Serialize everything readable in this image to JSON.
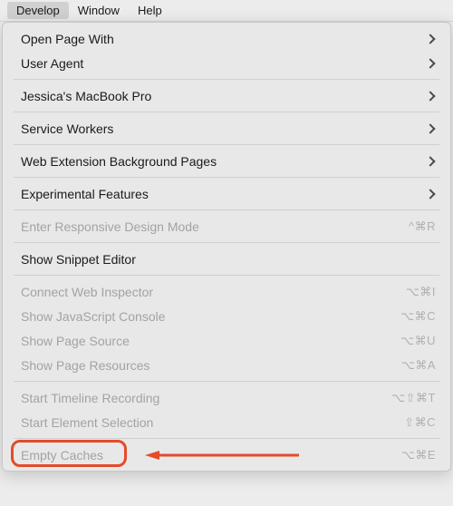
{
  "menubar": {
    "develop": "Develop",
    "window": "Window",
    "help": "Help"
  },
  "menu": {
    "open_page_with": "Open Page With",
    "user_agent": "User Agent",
    "device_name": "Jessica's MacBook Pro",
    "service_workers": "Service Workers",
    "web_ext_bg": "Web Extension Background Pages",
    "experimental": "Experimental Features",
    "responsive": "Enter Responsive Design Mode",
    "responsive_sc": "^⌘R",
    "snippet_editor": "Show Snippet Editor",
    "connect_inspector": "Connect Web Inspector",
    "connect_inspector_sc": "⌥⌘I",
    "js_console": "Show JavaScript Console",
    "js_console_sc": "⌥⌘C",
    "page_source": "Show Page Source",
    "page_source_sc": "⌥⌘U",
    "page_resources": "Show Page Resources",
    "page_resources_sc": "⌥⌘A",
    "timeline": "Start Timeline Recording",
    "timeline_sc": "⌥⇧⌘T",
    "element_sel": "Start Element Selection",
    "element_sel_sc": "⇧⌘C",
    "empty_caches": "Empty Caches",
    "empty_caches_sc": "⌥⌘E"
  }
}
